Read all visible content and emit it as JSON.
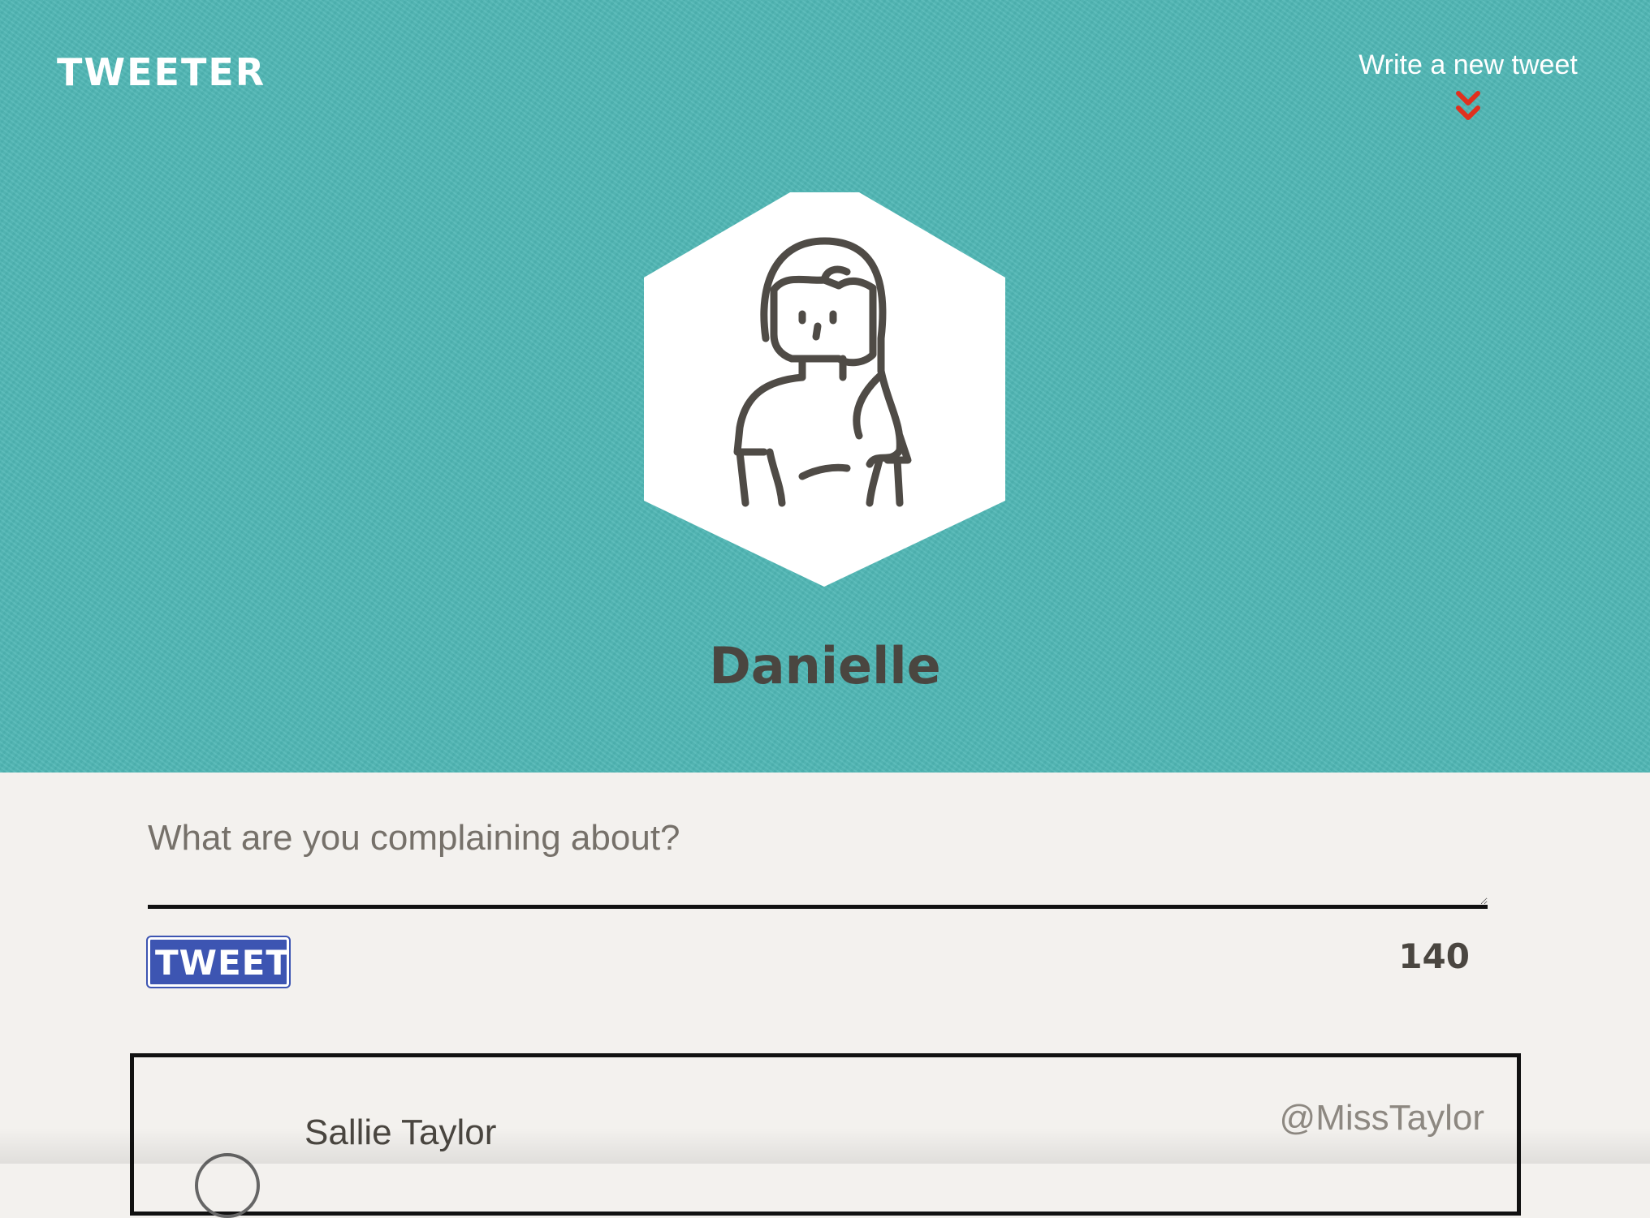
{
  "nav": {
    "logo": "TWEETER",
    "compose_label": "Write a new tweet",
    "compose_icon": "double-chevron-down-icon",
    "accent_color": "#e0301e"
  },
  "profile": {
    "name": "Danielle",
    "avatar_icon": "woman-avatar-icon"
  },
  "composer": {
    "placeholder": "What are you complaining about?",
    "value": "",
    "button_label": "TWEET",
    "char_count": "140"
  },
  "tweets": [
    {
      "author": "Sallie Taylor",
      "handle": "@MissTaylor"
    }
  ],
  "colors": {
    "header_bg": "#4fb7b5",
    "page_bg": "#f3f1ee",
    "button_bg": "#3d55b2",
    "text_dark": "#4a4640"
  }
}
